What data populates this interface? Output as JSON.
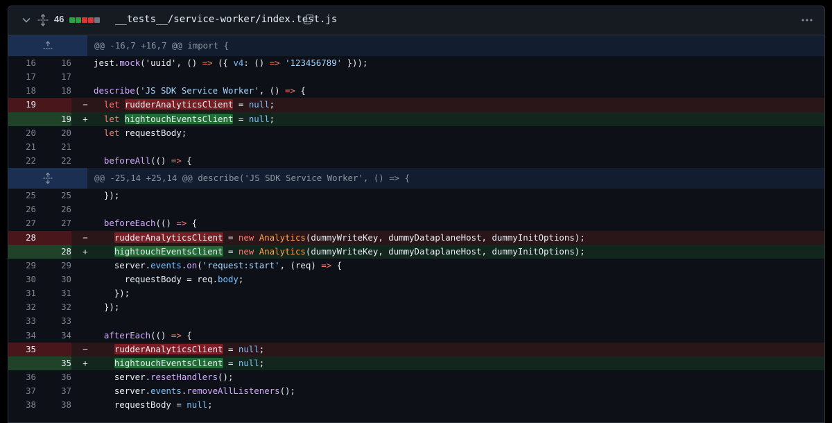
{
  "file": {
    "changes": "46",
    "path": "__tests__/service-worker/index.test.js",
    "diffstat": [
      "#2ea043",
      "#2ea043",
      "#da3633",
      "#da3633",
      "#6e7681"
    ]
  },
  "hunks": [
    "@@ -16,7 +16,7 @@ import {",
    "@@ -25,14 +25,14 @@ describe('JS SDK Service Worker', () => {"
  ],
  "lines": [
    {
      "old": "16",
      "new": "16",
      "type": "ctx",
      "t": [
        "jest.",
        "mock",
        "('uuid', () ",
        "=>",
        " ({ ",
        "v4",
        ": () ",
        "=>",
        " ",
        "'123456789'",
        " }));"
      ]
    },
    {
      "old": "17",
      "new": "17",
      "type": "ctx",
      "t": [
        ""
      ]
    },
    {
      "old": "18",
      "new": "18",
      "type": "ctx",
      "t": [
        "describe",
        "(",
        "'JS SDK Service Worker'",
        ", () ",
        "=>",
        " {"
      ]
    },
    {
      "old": "19",
      "new": "",
      "type": "del",
      "t": [
        "  ",
        "let",
        " ",
        "rudderAnalyticsClient",
        " = ",
        "null",
        ";"
      ]
    },
    {
      "old": "",
      "new": "19",
      "type": "add",
      "t": [
        "  ",
        "let",
        " ",
        "hightouchEventsClient",
        " = ",
        "null",
        ";"
      ]
    },
    {
      "old": "20",
      "new": "20",
      "type": "ctx",
      "t": [
        "  ",
        "let",
        " requestBody;"
      ]
    },
    {
      "old": "21",
      "new": "21",
      "type": "ctx",
      "t": [
        ""
      ]
    },
    {
      "old": "22",
      "new": "22",
      "type": "ctx",
      "t": [
        "  ",
        "beforeAll",
        "(() ",
        "=>",
        " {"
      ]
    },
    {
      "old": "25",
      "new": "25",
      "type": "ctx",
      "t": [
        "  });"
      ]
    },
    {
      "old": "26",
      "new": "26",
      "type": "ctx",
      "t": [
        ""
      ]
    },
    {
      "old": "27",
      "new": "27",
      "type": "ctx",
      "t": [
        "  ",
        "beforeEach",
        "(() ",
        "=>",
        " {"
      ]
    },
    {
      "old": "28",
      "new": "",
      "type": "del",
      "t": [
        "    ",
        "rudderAnalyticsClient",
        " = ",
        "new",
        " ",
        "Analytics",
        "(dummyWriteKey, dummyDataplaneHost, dummyInitOptions);"
      ]
    },
    {
      "old": "",
      "new": "28",
      "type": "add",
      "t": [
        "    ",
        "hightouchEventsClient",
        " = ",
        "new",
        " ",
        "Analytics",
        "(dummyWriteKey, dummyDataplaneHost, dummyInitOptions);"
      ]
    },
    {
      "old": "29",
      "new": "29",
      "type": "ctx",
      "t": [
        "    server.",
        "events",
        ".",
        "on",
        "(",
        "'request:start'",
        ", (req) ",
        "=>",
        " {"
      ]
    },
    {
      "old": "30",
      "new": "30",
      "type": "ctx",
      "t": [
        "      requestBody = req.",
        "body",
        ";"
      ]
    },
    {
      "old": "31",
      "new": "31",
      "type": "ctx",
      "t": [
        "    });"
      ]
    },
    {
      "old": "32",
      "new": "32",
      "type": "ctx",
      "t": [
        "  });"
      ]
    },
    {
      "old": "33",
      "new": "33",
      "type": "ctx",
      "t": [
        ""
      ]
    },
    {
      "old": "34",
      "new": "34",
      "type": "ctx",
      "t": [
        "  ",
        "afterEach",
        "(() ",
        "=>",
        " {"
      ]
    },
    {
      "old": "35",
      "new": "",
      "type": "del",
      "t": [
        "    ",
        "rudderAnalyticsClient",
        " = ",
        "null",
        ";"
      ]
    },
    {
      "old": "",
      "new": "35",
      "type": "add",
      "t": [
        "    ",
        "hightouchEventsClient",
        " = ",
        "null",
        ";"
      ]
    },
    {
      "old": "36",
      "new": "36",
      "type": "ctx",
      "t": [
        "    server.",
        "resetHandlers",
        "();"
      ]
    },
    {
      "old": "37",
      "new": "37",
      "type": "ctx",
      "t": [
        "    server.",
        "events",
        ".",
        "removeAllListeners",
        "();"
      ]
    },
    {
      "old": "38",
      "new": "38",
      "type": "ctx",
      "t": [
        "    requestBody = ",
        "null",
        ";"
      ]
    }
  ],
  "markers": {
    "del": "−",
    "add": "+"
  },
  "icons": [
    "chevron-down-icon",
    "unfold-icon",
    "copy-icon",
    "kebab-horizontal-icon"
  ]
}
